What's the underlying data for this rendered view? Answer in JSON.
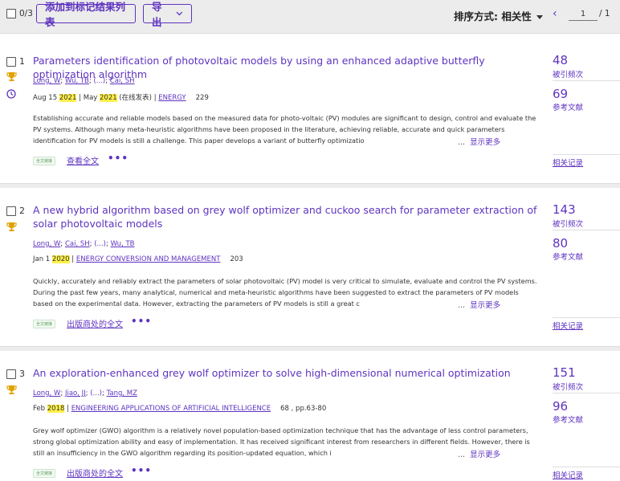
{
  "toolbar": {
    "selected_count": "0/3",
    "add_to_marked_label": "添加到标记结果列表",
    "export_label": "导出",
    "sort_label": "排序方式: 相关性",
    "page_current": "1",
    "page_total": "/ 1"
  },
  "records": [
    {
      "number": "1",
      "title": "Parameters identification of photovoltaic models by using an enhanced adaptive butterfly optimization algorithm",
      "authors": [
        "Long, W",
        "Wu, TB",
        "(...)",
        "Cai, SH"
      ],
      "date_prefix": "Aug 15 ",
      "year": "2021",
      "date_mid": " | May ",
      "year2": "2021",
      "date_suffix": " (在线发表) | ",
      "journal": "ENERGY",
      "volume": "229",
      "abstract": "Establishing accurate and reliable models based on the measured data for photo-voltaic (PV) modules are significant to design, control and evaluate the PV systems. Although many meta-heuristic algorithms have been proposed in the literature, achieving reliable, accurate and quick parameters identification for PV models is still a challenge. This paper develops a variant of butterfly optimizatio",
      "show_more": "显示更多",
      "full_text_badge": "全文链接",
      "full_text_link": "查看全文",
      "citations": "48",
      "citations_label": "被引频次",
      "references": "69",
      "references_label": "参考文献",
      "related": "相关记录"
    },
    {
      "number": "2",
      "title": "A new hybrid algorithm based on grey wolf optimizer and cuckoo search for parameter extraction of solar photovoltaic models",
      "authors": [
        "Long, W",
        "Cai, SH",
        "(...)",
        "Wu, TB"
      ],
      "date_prefix": "Jan 1 ",
      "year": "2020",
      "date_suffix": " | ",
      "journal": "ENERGY CONVERSION AND MANAGEMENT",
      "volume": "203",
      "abstract": "Quickly, accurately and reliably extract the parameters of solar photovoltaic (PV) model is very critical to simulate, evaluate and control the PV systems. During the past few years, many analytical, numerical and meta-heuristic algorithms have been suggested to extract the parameters of PV models based on the experimental data. However, extracting the parameters of PV models is still a great c",
      "show_more": "显示更多",
      "full_text_badge": "全文链接",
      "full_text_link": "出版商处的全文",
      "citations": "143",
      "citations_label": "被引频次",
      "references": "80",
      "references_label": "参考文献",
      "related": "相关记录"
    },
    {
      "number": "3",
      "title": "An exploration-enhanced grey wolf optimizer to solve high-dimensional numerical optimization",
      "authors": [
        "Long, W",
        "Jiao, JJ",
        "(...)",
        "Tang, MZ"
      ],
      "date_prefix": "Feb ",
      "year": "2018",
      "date_suffix": " | ",
      "journal": "ENGINEERING APPLICATIONS OF ARTIFICIAL INTELLIGENCE",
      "volume": "68 , pp.63-80",
      "abstract": "Grey wolf optimizer (GWO) algorithm is a relatively novel population-based optimization technique that has the advantage of less control parameters, strong global optimization ability and easy of implementation. It has received significant interest from researchers in different fields. However, there is still an insufficiency in the GWO algorithm regarding its position-updated equation, which i",
      "show_more": "显示更多",
      "full_text_badge": "全文链接",
      "full_text_link": "出版商处的全文",
      "citations": "151",
      "citations_label": "被引频次",
      "references": "96",
      "references_label": "参考文献",
      "related": "相关记录"
    }
  ],
  "colors": {
    "accent": "#5e33bf",
    "highlight": "#fff04a",
    "award": "#e0a200"
  },
  "icons": {
    "award": "trophy-icon",
    "clock": "clock-icon",
    "more": "more-options-icon"
  }
}
